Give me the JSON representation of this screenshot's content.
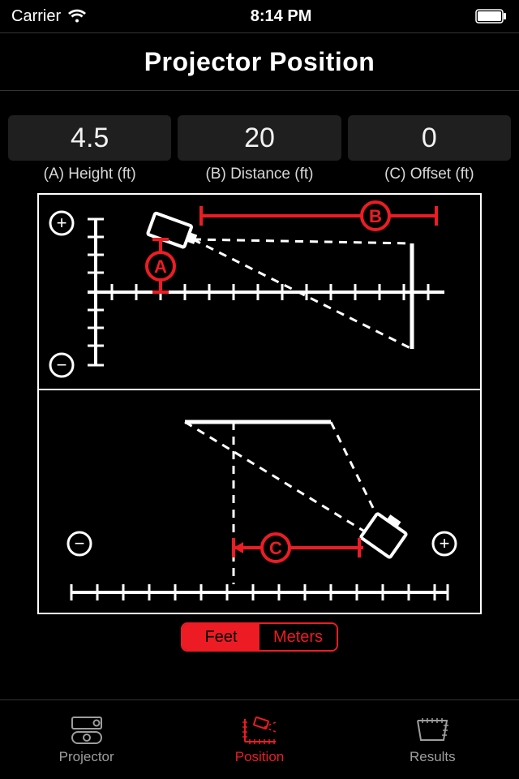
{
  "status_bar": {
    "carrier": "Carrier",
    "time": "8:14 PM"
  },
  "header": {
    "title": "Projector Position"
  },
  "values": {
    "height": {
      "value": "4.5",
      "label": "(A) Height (ft)"
    },
    "distance": {
      "value": "20",
      "label": "(B) Distance (ft)"
    },
    "offset": {
      "value": "0",
      "label": "(C) Offset (ft)"
    }
  },
  "diagram": {
    "label_a": "A",
    "label_b": "B",
    "label_c": "C",
    "plus": "+",
    "minus": "−"
  },
  "units": {
    "feet": "Feet",
    "meters": "Meters",
    "selected": "feet"
  },
  "tabs": {
    "projector": "Projector",
    "position": "Position",
    "results": "Results",
    "active": "position"
  },
  "colors": {
    "accent": "#ed1c24",
    "panel": "#1f1f1f"
  }
}
